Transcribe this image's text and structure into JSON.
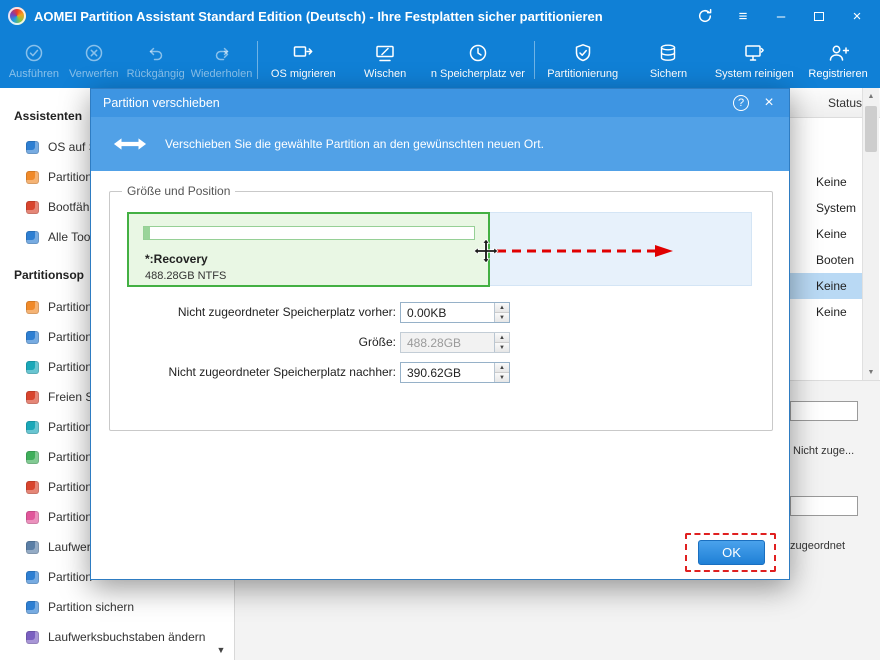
{
  "window": {
    "title": "AOMEI Partition Assistant Standard Edition (Deutsch) - Ihre Festplatten sicher partitionieren"
  },
  "glyphs": {
    "menu": "≡",
    "minimize": "–",
    "close": "×",
    "up_arrow": "▲",
    "down_arrow": "▼"
  },
  "toolbar": {
    "items": [
      {
        "label": "Ausführen",
        "icon": "run-check-icon",
        "disabled": true
      },
      {
        "label": "Verwerfen",
        "icon": "discard-x-icon",
        "disabled": true
      },
      {
        "label": "Rückgängig",
        "icon": "undo-icon",
        "disabled": true
      },
      {
        "label": "Wiederholen",
        "icon": "redo-icon",
        "disabled": true
      },
      {
        "label": "OS migrieren",
        "icon": "migrate-os-icon",
        "disabled": false
      },
      {
        "label": "Wischen",
        "icon": "wipe-icon",
        "disabled": false
      },
      {
        "label": "n Speicherplatz ver",
        "icon": "clock-icon",
        "disabled": false
      },
      {
        "label": "Partitionierung",
        "icon": "shield-icon",
        "disabled": false
      },
      {
        "label": "Sichern",
        "icon": "backup-icon",
        "disabled": false
      },
      {
        "label": "System reinigen",
        "icon": "clean-system-icon",
        "disabled": false
      },
      {
        "label": "Registrieren",
        "icon": "register-user-icon",
        "disabled": false
      }
    ]
  },
  "sidebar": {
    "sections": [
      {
        "header": "Assistenten",
        "items": [
          {
            "label": "OS auf S",
            "color": "#2e7fd2"
          },
          {
            "label": "Partition",
            "color": "#f08a2a"
          },
          {
            "label": "Bootfähi",
            "color": "#d8452e"
          },
          {
            "label": "Alle Tool",
            "color": "#2e7fd2"
          }
        ]
      },
      {
        "header": "Partitionsop",
        "items": [
          {
            "label": "Partition",
            "color": "#f08a2a"
          },
          {
            "label": "Partition",
            "color": "#2e7fd2"
          },
          {
            "label": "Partition",
            "color": "#1aa7b8"
          },
          {
            "label": "Freien Sp",
            "color": "#d8452e"
          },
          {
            "label": "Partition",
            "color": "#1aa7b8"
          },
          {
            "label": "Partition",
            "color": "#3fae5a"
          },
          {
            "label": "Partition",
            "color": "#d8452e"
          },
          {
            "label": "Partition",
            "color": "#e0569a"
          },
          {
            "label": "Laufwerk",
            "color": "#5b7fa6"
          },
          {
            "label": "Partition",
            "color": "#2e7fd2"
          },
          {
            "label": "Partition sichern",
            "color": "#2e7fd2"
          },
          {
            "label": "Laufwerksbuchstaben ändern",
            "color": "#7a5fc0"
          }
        ]
      }
    ]
  },
  "main": {
    "status_header": "Status",
    "rows": [
      "Keine",
      "System",
      "Keine",
      "Booten",
      "Keine",
      "Keine"
    ],
    "panel_labels": [
      "Nicht zuge...",
      "zugeordnet"
    ]
  },
  "dialog": {
    "title": "Partition verschieben",
    "help_label": "?",
    "description": "Verschieben Sie die gewählte Partition an den gewünschten neuen Ort.",
    "group_label": "Größe und Position",
    "partition_name": "*:Recovery",
    "partition_size": "488.28GB NTFS",
    "fields": [
      {
        "label": "Nicht zugeordneter Speicherplatz vorher:",
        "value": "0.00KB"
      },
      {
        "label": "Größe:",
        "value": "488.28GB"
      },
      {
        "label": "Nicht zugeordneter Speicherplatz nachher:",
        "value": "390.62GB"
      }
    ],
    "ok_label": "OK"
  },
  "colors": {
    "titlebar_blue": "#1080d6",
    "dialog_header_blue": "#4d9fe6",
    "partition_green_border": "#43b043",
    "annotation_red": "#e02020",
    "selection_blue": "#b9d9f4"
  }
}
